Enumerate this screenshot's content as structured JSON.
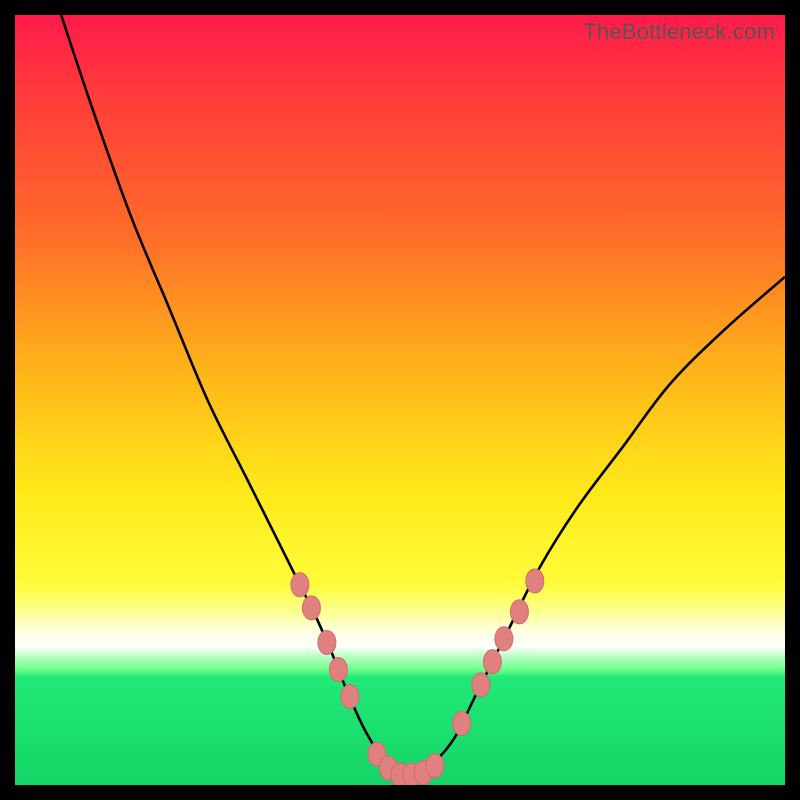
{
  "watermark": "TheBottleneck.com",
  "colors": {
    "frame": "#000000",
    "curve": "#000000",
    "marker_fill": "#e08080",
    "marker_stroke": "#d46a6a"
  },
  "chart_data": {
    "type": "line",
    "title": "",
    "xlabel": "",
    "ylabel": "",
    "xlim": [
      0,
      100
    ],
    "ylim": [
      0,
      100
    ],
    "grid": false,
    "series": [
      {
        "name": "curve",
        "x": [
          6,
          10,
          15,
          20,
          25,
          30,
          34,
          37,
          39,
          41,
          43,
          45,
          47,
          49,
          50.5,
          52,
          54,
          57,
          60,
          64,
          68,
          73,
          79,
          85,
          92,
          100
        ],
        "values": [
          100,
          88,
          74,
          62,
          50,
          40,
          32,
          26,
          22,
          17.5,
          12.5,
          8,
          4.5,
          2,
          1.3,
          1.3,
          2.5,
          6,
          12,
          20,
          28,
          36,
          44,
          52,
          59,
          66
        ]
      }
    ],
    "markers": [
      {
        "x": 37.0,
        "y": 26.0
      },
      {
        "x": 38.5,
        "y": 23.0
      },
      {
        "x": 40.5,
        "y": 18.5
      },
      {
        "x": 42.0,
        "y": 15.0
      },
      {
        "x": 43.5,
        "y": 11.5
      },
      {
        "x": 47.0,
        "y": 4.0
      },
      {
        "x": 48.5,
        "y": 2.2
      },
      {
        "x": 50.0,
        "y": 1.3
      },
      {
        "x": 51.5,
        "y": 1.3
      },
      {
        "x": 53.0,
        "y": 1.6
      },
      {
        "x": 54.5,
        "y": 2.5
      },
      {
        "x": 58.0,
        "y": 8.0
      },
      {
        "x": 60.5,
        "y": 13.0
      },
      {
        "x": 62.0,
        "y": 16.0
      },
      {
        "x": 63.5,
        "y": 19.0
      },
      {
        "x": 65.5,
        "y": 22.5
      },
      {
        "x": 67.5,
        "y": 26.5
      }
    ]
  }
}
